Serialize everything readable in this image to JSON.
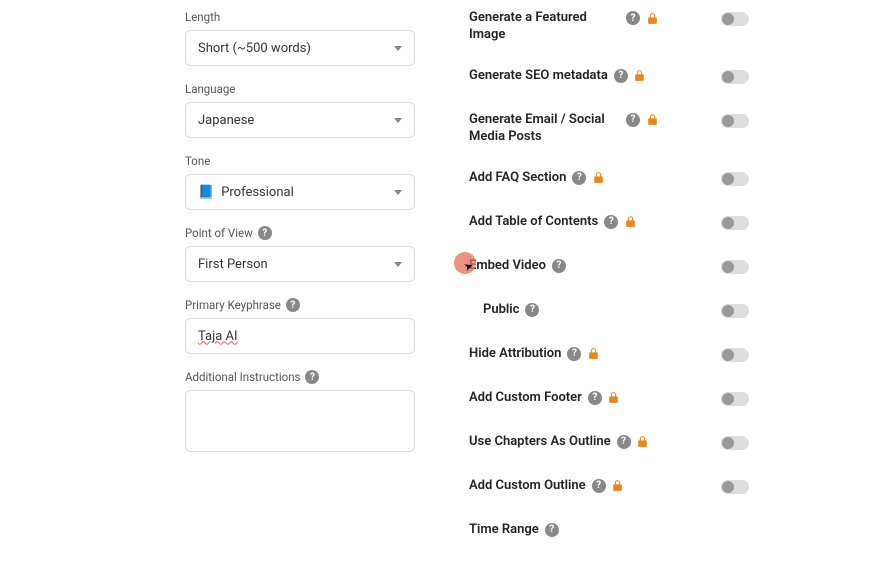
{
  "left": {
    "length": {
      "label": "Length",
      "value": "Short (~500 words)"
    },
    "language": {
      "label": "Language",
      "value": "Japanese"
    },
    "tone": {
      "label": "Tone",
      "value": "Professional",
      "icon": "📘"
    },
    "pov": {
      "label": "Point of View",
      "value": "First Person"
    },
    "keyphrase": {
      "label": "Primary Keyphrase",
      "value": "Taja AI"
    },
    "instructions": {
      "label": "Additional Instructions",
      "value": ""
    }
  },
  "right": [
    {
      "label": "Generate a Featured Image",
      "help": true,
      "lock": true,
      "toggle": false
    },
    {
      "label": "Generate SEO metadata",
      "help": true,
      "lock": true,
      "toggle": false
    },
    {
      "label": "Generate Email / Social Media Posts",
      "help": true,
      "lock": true,
      "toggle": false
    },
    {
      "label": "Add FAQ Section",
      "help": true,
      "lock": true,
      "toggle": false
    },
    {
      "label": "Add Table of Contents",
      "help": true,
      "lock": true,
      "toggle": false
    },
    {
      "label": "Embed Video",
      "help": true,
      "lock": false,
      "toggle": false
    },
    {
      "label": "Public",
      "help": true,
      "lock": false,
      "toggle": false,
      "indent": true
    },
    {
      "label": "Hide Attribution",
      "help": true,
      "lock": true,
      "toggle": false
    },
    {
      "label": "Add Custom Footer",
      "help": true,
      "lock": true,
      "toggle": false
    },
    {
      "label": "Use Chapters As Outline",
      "help": true,
      "lock": true,
      "toggle": false
    },
    {
      "label": "Add Custom Outline",
      "help": true,
      "lock": true,
      "toggle": false
    },
    {
      "label": "Time Range",
      "help": true,
      "lock": false,
      "toggle": null
    }
  ]
}
